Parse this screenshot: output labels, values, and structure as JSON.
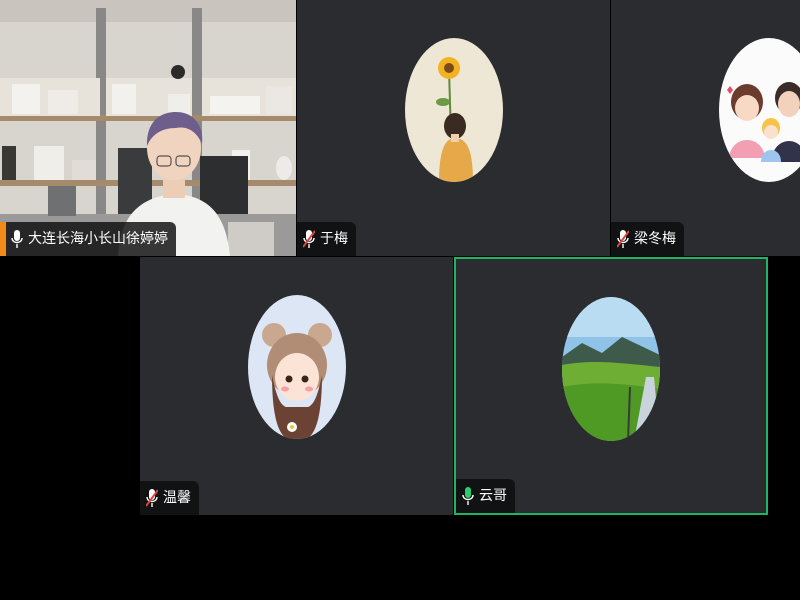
{
  "participants": [
    {
      "name": "大连长海小长山徐婷婷",
      "mic": "on",
      "video": true
    },
    {
      "name": "于梅",
      "mic": "muted"
    },
    {
      "name": "梁冬梅",
      "mic": "muted"
    },
    {
      "name": "温馨",
      "mic": "muted"
    },
    {
      "name": "云哥",
      "mic": "active",
      "active_speaker": true
    }
  ],
  "colors": {
    "tile_bg": "#2a2c2f",
    "active_border": "#1fb463",
    "muted_icon": "#e0473c",
    "mic_icon": "#ffffff",
    "speaking_icon": "#2ecc71",
    "accent_tag": "#f28a1a"
  },
  "icons": {
    "mic_on": "microphone-icon",
    "mic_muted": "microphone-muted-icon",
    "mic_speaking": "microphone-speaking-icon"
  }
}
